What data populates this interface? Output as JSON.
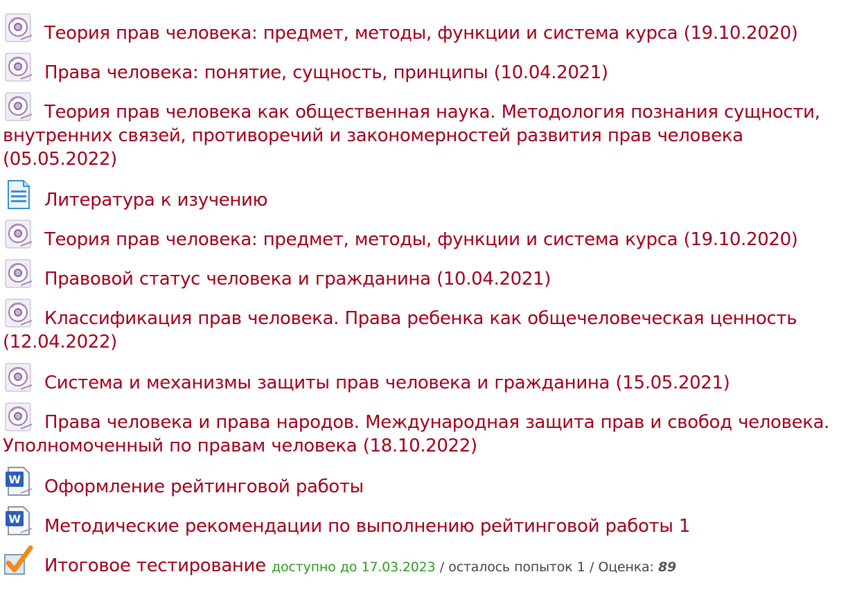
{
  "items": [
    {
      "icon": "video-disc-icon",
      "label": "Теория прав человека: предмет, методы, функции и система курса (19.10.2020)"
    },
    {
      "icon": "video-disc-icon",
      "label": "Права человека: понятие, сущность, принципы (10.04.2021)"
    },
    {
      "icon": "video-disc-icon",
      "label": "Теория прав человека как общественная наука. Методология познания сущности, внутренних связей, противоречий и закономерностей развития прав человека (05.05.2022)"
    },
    {
      "icon": "page-icon",
      "label": "Литература к изучению"
    },
    {
      "icon": "video-disc-icon",
      "label": "Теория прав человека: предмет, методы, функции и система курса (19.10.2020)"
    },
    {
      "icon": "video-disc-icon",
      "label": "Правовой статус человека и гражданина (10.04.2021)"
    },
    {
      "icon": "video-disc-icon",
      "label": "Классификация прав человека. Права ребенка как общечеловеческая ценность (12.04.2022)"
    },
    {
      "icon": "video-disc-icon",
      "label": "Система и механизмы защиты прав человека и гражданина (15.05.2021)"
    },
    {
      "icon": "video-disc-icon",
      "label": "Права человека и права народов. Международная защита прав и свобод человека. Уполномоченный по правам человека (18.10.2022)"
    },
    {
      "icon": "word-document-icon",
      "label": "Оформление рейтинговой работы"
    },
    {
      "icon": "word-document-icon",
      "label": "Методические рекомендации по выполнению рейтинговой работы 1"
    }
  ],
  "quiz": {
    "icon": "checkmark-icon",
    "label": "Итоговое тестирование",
    "available": "доступно до 17.03.2023",
    "attempts": " / осталось попыток 1 / Оценка: ",
    "grade": "89"
  },
  "colors": {
    "link": "#a3001a",
    "available": "#2e9a22"
  }
}
